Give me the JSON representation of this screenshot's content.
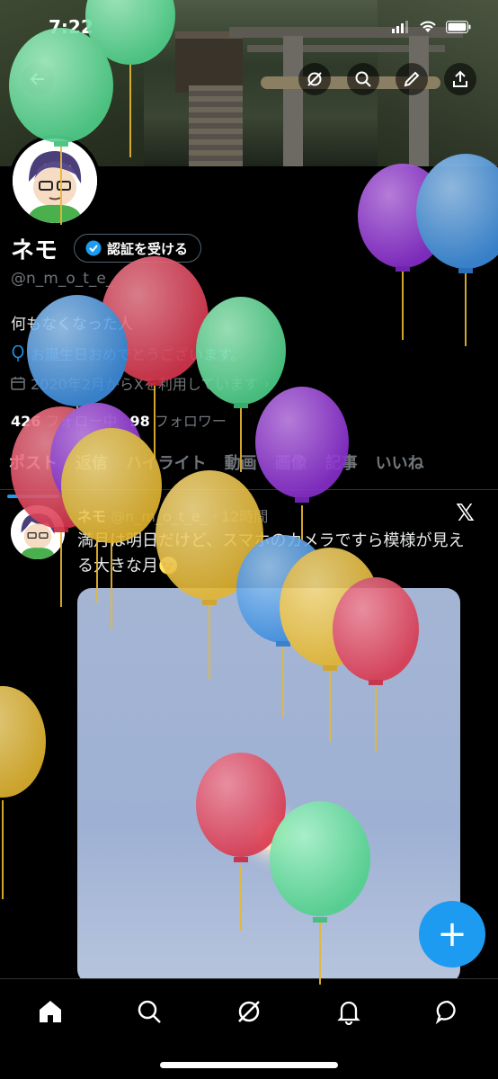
{
  "status_bar": {
    "time": "7:22"
  },
  "profile": {
    "name": "ネモ",
    "verify_label": "認証を受ける",
    "handle": "@n_m_o_t_e_",
    "bio": "何もなくなった人",
    "birthday": "お誕生日おめでとうございます。",
    "joined": "2020年2月からXを利用しています",
    "following_count": "426",
    "following_label": "フォロー中",
    "followers_count": "98",
    "followers_label": "フォロワー"
  },
  "tabs": [
    "ポスト",
    "返信",
    "ハイライト",
    "動画",
    "画像",
    "記事",
    "いいね"
  ],
  "post": {
    "author": "ネモ",
    "handle": "@n_m_o_t_e_",
    "time": "· 12時間",
    "text": "満月は明日だけど、スマホのカメラですら模様が見える大きな月🌝"
  },
  "fab_label": "+",
  "colors": {
    "accent": "#1d9bf0",
    "background": "#000000"
  },
  "icons": [
    "back-icon",
    "grok-icon",
    "search-icon",
    "edit-icon",
    "share-icon",
    "verified-icon",
    "balloon-icon",
    "calendar-icon",
    "x-logo-icon",
    "plus-icon",
    "home-icon",
    "explore-icon",
    "grok-nav-icon",
    "notifications-icon",
    "messages-icon"
  ]
}
